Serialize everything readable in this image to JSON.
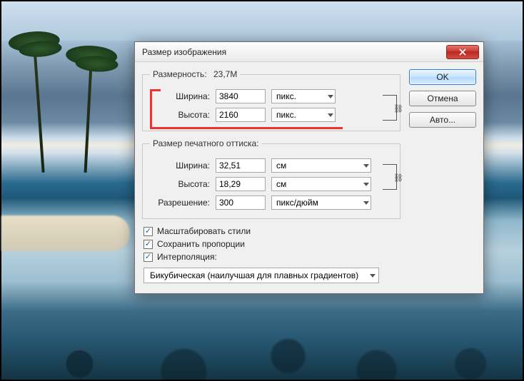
{
  "dialog": {
    "title": "Размер изображения",
    "dimensions": {
      "legend": "Размерность:",
      "value": "23,7M",
      "width_label": "Ширина:",
      "width_value": "3840",
      "width_unit": "пикс.",
      "height_label": "Высота:",
      "height_value": "2160",
      "height_unit": "пикс."
    },
    "print": {
      "legend": "Размер печатного оттиска:",
      "width_label": "Ширина:",
      "width_value": "32,51",
      "width_unit": "см",
      "height_label": "Высота:",
      "height_value": "18,29",
      "height_unit": "см",
      "res_label": "Разрешение:",
      "res_value": "300",
      "res_unit": "пикс/дюйм"
    },
    "checks": {
      "scale_styles": "Масштабировать стили",
      "constrain": "Сохранить пропорции",
      "interp_label": "Интерполяция:"
    },
    "interp_value": "Бикубическая (наилучшая для плавных градиентов)",
    "buttons": {
      "ok": "OK",
      "cancel": "Отмена",
      "auto": "Авто..."
    }
  }
}
